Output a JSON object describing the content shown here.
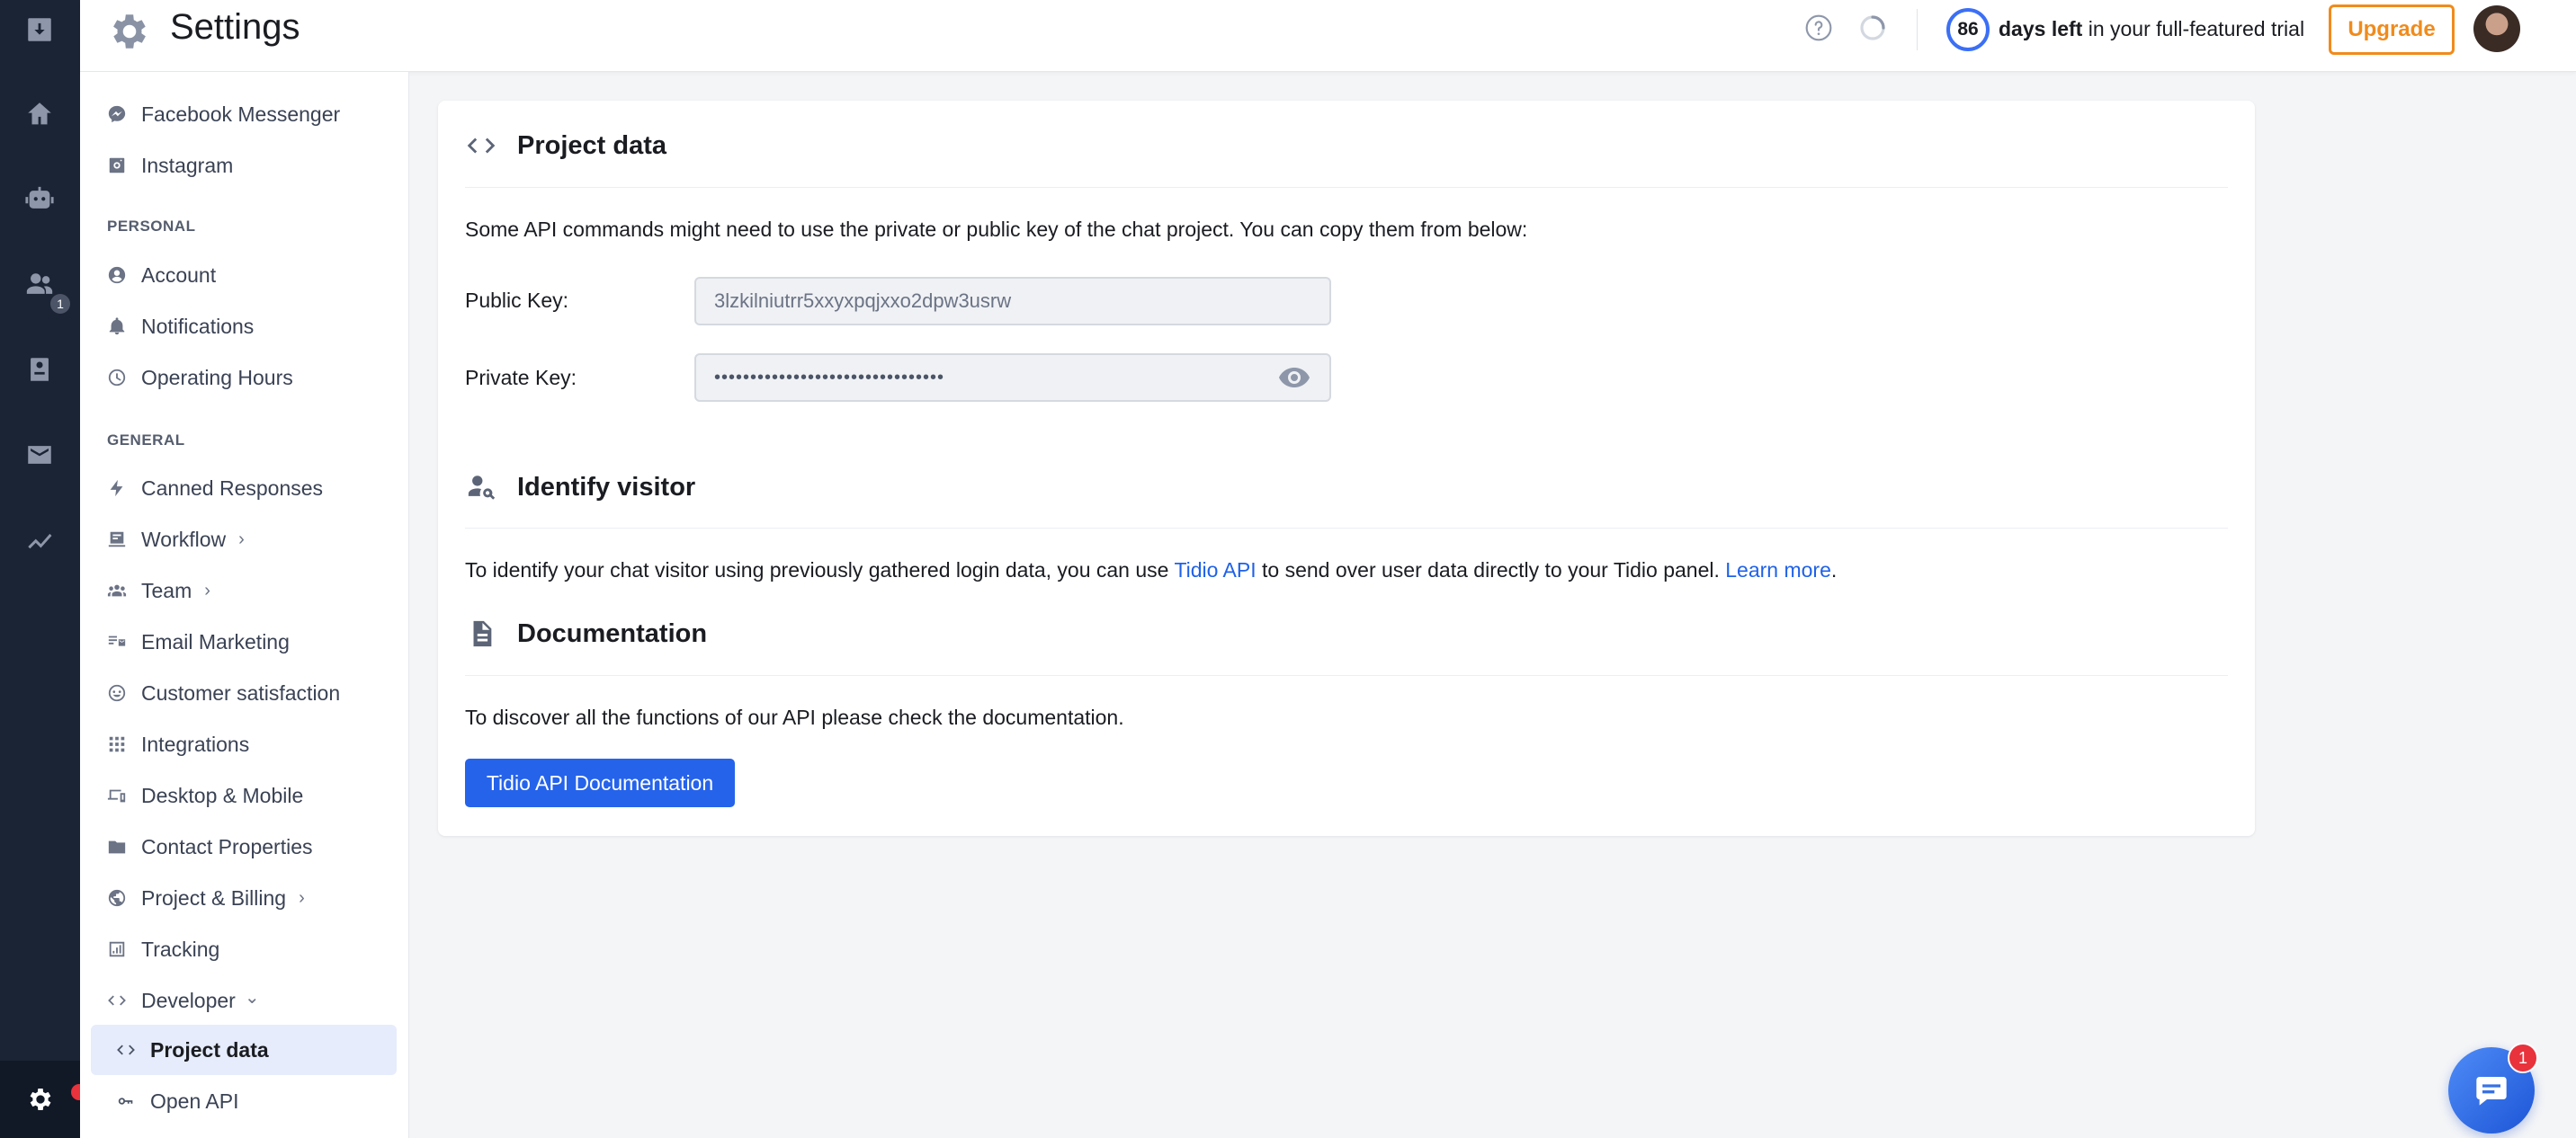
{
  "header": {
    "title": "Settings",
    "trial_days": "86",
    "trial_bold": "days left",
    "trial_rest": " in your full-featured trial",
    "upgrade_label": "Upgrade"
  },
  "rail": {
    "contacts_badge": "1"
  },
  "sidebar": {
    "top_items": [
      {
        "label": "Facebook Messenger",
        "icon": "messenger-icon"
      },
      {
        "label": "Instagram",
        "icon": "instagram-icon"
      }
    ],
    "personal_heading": "PERSONAL",
    "personal_items": [
      {
        "label": "Account",
        "icon": "account-icon"
      },
      {
        "label": "Notifications",
        "icon": "bell-icon"
      },
      {
        "label": "Operating Hours",
        "icon": "clock-icon"
      }
    ],
    "general_heading": "GENERAL",
    "general_items": [
      {
        "label": "Canned Responses",
        "icon": "bolt-icon"
      },
      {
        "label": "Workflow",
        "icon": "workflow-icon",
        "chevron": "›"
      },
      {
        "label": "Team",
        "icon": "team-icon",
        "chevron": "›"
      },
      {
        "label": "Email Marketing",
        "icon": "email-marketing-icon"
      },
      {
        "label": "Customer satisfaction",
        "icon": "smile-icon"
      },
      {
        "label": "Integrations",
        "icon": "grid-icon"
      },
      {
        "label": "Desktop & Mobile",
        "icon": "devices-icon"
      },
      {
        "label": "Contact Properties",
        "icon": "folder-icon"
      },
      {
        "label": "Project & Billing",
        "icon": "globe-icon",
        "chevron": "›"
      },
      {
        "label": "Tracking",
        "icon": "chart-icon"
      },
      {
        "label": "Developer",
        "icon": "code-icon",
        "chevron": "⌄"
      }
    ],
    "developer_items": [
      {
        "label": "Project data",
        "icon": "code-icon",
        "active": true
      },
      {
        "label": "Open API",
        "icon": "key-icon"
      }
    ]
  },
  "project_data": {
    "title": "Project data",
    "intro": "Some API commands might need to use the private or public key of the chat project. You can copy them from below:",
    "public_key_label": "Public Key:",
    "public_key_value": "3lzkilniutrr5xxyxpqjxxo2dpw3usrw",
    "private_key_label": "Private Key:",
    "private_key_value": "••••••••••••••••••••••••••••••••"
  },
  "identify_visitor": {
    "title": "Identify visitor",
    "text_before": "To identify your chat visitor using previously gathered login data, you can use ",
    "link_api": "Tidio API",
    "text_middle": " to send over user data directly to your Tidio panel. ",
    "link_learn": "Learn more",
    "text_after": "."
  },
  "documentation": {
    "title": "Documentation",
    "text": "To discover all the functions of our API please check the documentation.",
    "button_label": "Tidio API Documentation"
  },
  "chat_widget": {
    "badge": "1"
  },
  "colors": {
    "rail_bg": "#1b2434",
    "accent": "#2563eb",
    "upgrade": "#f08b1c",
    "active_bg": "#e6ecfb",
    "alert": "#e8323c"
  }
}
